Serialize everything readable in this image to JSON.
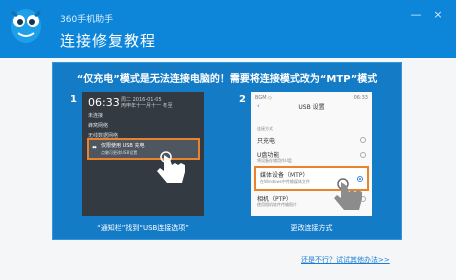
{
  "app": {
    "name": "360手机助手",
    "page_title": "连接修复教程"
  },
  "window_controls": {
    "minimize": "—",
    "close": "×"
  },
  "headline": "“仅充电”模式是无法连接电脑的！需要将连接模式改为“MTP”模式",
  "steps": [
    {
      "number": "1",
      "caption": "“通知栏”找到“USB连接选项”"
    },
    {
      "number": "2",
      "caption": "更改连接方式"
    }
  ],
  "phone1": {
    "time": "06:33",
    "date_line1": "周二 2016-01-05",
    "date_line2": "丙申年十一月十一 冬至",
    "rows": [
      "未连接",
      "蜂窝网络",
      "无线数据网络"
    ],
    "notification_title": "仅限使用 USB 充电",
    "notification_sub": "点触可更改USB设置"
  },
  "phone2": {
    "status_left": "BGM ◇",
    "status_right": "06:33",
    "title": "USB 设置",
    "section": "连接方式",
    "options": [
      {
        "label": "只充电",
        "sub": ""
      },
      {
        "label": "U盘功能",
        "sub": "将设备存储用作U盘"
      },
      {
        "label": "媒体设备（MTP）",
        "sub": "在Windows中传输媒体文件"
      },
      {
        "label": "相机（PTP）",
        "sub": "使用相机软件传输照片"
      }
    ]
  },
  "footer_link": "还是不行？试试其他办法>>",
  "colors": {
    "brand": "#0d86d9",
    "panel": "#147bc7",
    "highlight": "#e9832c",
    "link": "#1a7cd3"
  }
}
